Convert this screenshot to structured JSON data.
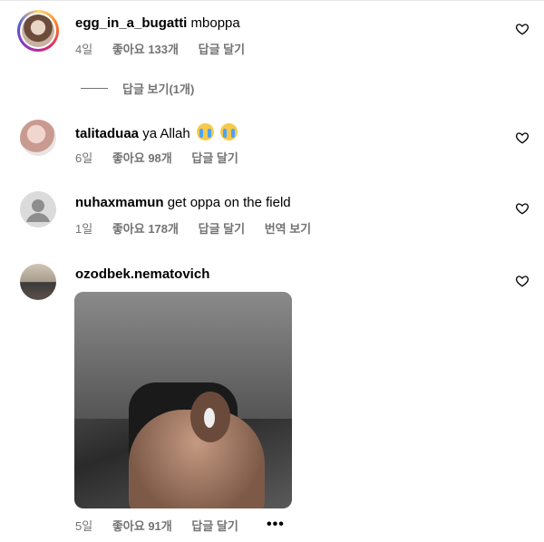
{
  "comments": [
    {
      "username": "egg_in_a_bugatti",
      "text": "mboppa",
      "time": "4일",
      "likes": "좋아요 133개",
      "reply": "답글 달기",
      "view_replies": "답글 보기(1개)",
      "avatar_icon": "user-avatar-with-story-ring"
    },
    {
      "username": "talitaduaa",
      "text": "ya Allah",
      "emojis": [
        "loudly-crying-face",
        "loudly-crying-face"
      ],
      "time": "6일",
      "likes": "좋아요 98개",
      "reply": "답글 달기",
      "avatar_icon": "user-avatar"
    },
    {
      "username": "nuhaxmamun",
      "text": "get oppa on the field",
      "time": "1일",
      "likes": "좋아요 178개",
      "reply": "답글 달기",
      "translate": "번역 보기",
      "avatar_icon": "default-user-avatar"
    },
    {
      "username": "ozodbek.nematovich",
      "text": "",
      "time": "5일",
      "likes": "좋아요 91개",
      "reply": "답글 달기",
      "more": "•••",
      "avatar_icon": "user-avatar",
      "media": "animated-gif-image"
    }
  ],
  "icons": {
    "like": "heart-outline-icon"
  },
  "colors": {
    "meta_text": "#737373",
    "story_ring": "#d62976"
  }
}
